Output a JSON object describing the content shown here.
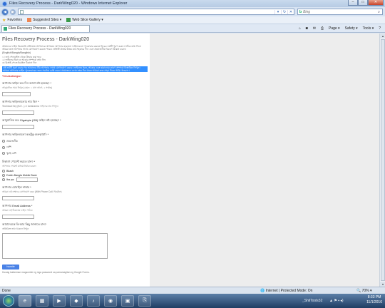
{
  "window": {
    "title": "Files Recovery Process - DarkWing020 - Windows Internet Explorer",
    "min": "–",
    "max": "□",
    "close": "✕"
  },
  "address": {
    "back": "◀",
    "forward": "▶",
    "url": "",
    "search_placeholder": "Bing",
    "search_brand": "b"
  },
  "favorites": {
    "label": "Favorites",
    "items": [
      "Suggested Sites ▾",
      "Web Slice Gallery ▾"
    ]
  },
  "tab": {
    "label": "Files Recovery Process - DarkWing020"
  },
  "toolbar": {
    "page": "Page ▾",
    "safety": "Safety ▾",
    "tools": "Tools ▾",
    "help": "?"
  },
  "form": {
    "title": "Files Recovery Process - DarkWing020",
    "intro": "আমাদের ফাইল রিকভারি প্রক্রিয়ায় আপনাকে স্বাগতম। আপনার হারানো ফাইলগুলো পুনরুদ্ধার করতে নিচের ফর্মটি পূরণ করুন। সঠিক তথ্য দিলে আমরা দ্রুত আপনার সাথে যোগাযোগ করতে পারব। প্রতিটি প্রশ্নের উত্তর যত্ন সহকারে দিন এবং প্রয়োজনীয় বিবরণ উল্লেখ করুন। (English/Bangla/Banglish)",
    "note1": "১। শুধু পেনড্রাইভ থেকে উদ্ধার করা হবে",
    "note2": "২। ফাইলের ধরন ও আকার সম্পর্কে তথ্য দিন",
    "note3": "৩। রিপ্লাই পেতে ইমেইল ঠিকানা দিন",
    "highlight": "এই ফর্মটি পূরণ করার পর আমাদের টিম আপনার সাথে যোগাযোগ করবে। ফাইলের ধরন, আকার এবং হারানোর কারণ সম্পর্কে বিস্তারিত লিখুন। আমরা আপনার ফাইল পুনরুদ্ধারের জন্য সর্বোচ্চ চেষ্টা করব। প্রয়োজনে ফোন নম্বর দিন যাতে আমরা দ্রুত সাড়া দিতে পারি। ধন্যবাদ।",
    "required": "*Kinakailangan",
    "questions": [
      {
        "q": "আপনার ফাইল কত দিন আগে নষ্ট হয়েছে? *",
        "hint": "আনুমানিক সময় লিখুন (যেমন: ১ মাস আগে, ২ সপ্তাহ)"
      },
      {
        "q": "আপনার ফাইলগুলোর নাম কি? *",
        "hint": "Technical Key (B.E...) বা Anisharma ফাইলের নাম লিখুন।"
      },
      {
        "q": "আনুমানিক কত Gigabyte (GB) ফাইল নষ্ট হয়েছে? *",
        "hint": ""
      },
      {
        "q": "আপনার ফাইলগুলো কতটুকু গুরুত্বপূর্ণ? *",
        "hint": "",
        "options": [
          "প্রয়োজনীয়",
          "বেশি",
          "খুবই বেশি"
        ]
      },
      {
        "q": "বিকাশে পেমেন্ট করতে চান? *",
        "hint": "আপনার পেমেন্ট মাধ্যম নির্বাচন করুন",
        "options": [
          "Bkash",
          "Dutch-Bangla Mobile Bank",
          "Iba pa:"
        ]
      },
      {
        "q": "আপনার মোবাইল নাম্বার *",
        "hint": "আমরা এই নাম্বারে যোগাযোগ করব (With Phone Call / ইমেইল)"
      },
      {
        "q": "আপনার Email Address *",
        "hint": "আমরা এই ঠিকানায় ফাইল পাঠাব"
      },
      {
        "q": "আমাদেরকে কি আর কিছু জানাতে চান?",
        "hint": "অতিরিক্ত তথ্য থাকলে লিখুন"
      }
    ],
    "submit": "Isumite",
    "footer": "Huwag kailanman magsumite ng mga password sa pamamagitan ng Google Forms."
  },
  "status": {
    "left": "Done",
    "zone": "Internet | Protected Mode: On",
    "zoom": "70%"
  },
  "taskbar": {
    "apps": [
      "e",
      "▦",
      "▶",
      "◆",
      "♪",
      "◉",
      "▣",
      "⎘"
    ],
    "user": "_ShilTools32",
    "time": "8:33 PM",
    "date": "11/1/2016",
    "tray": "▲ ⚑ ▪ ◂)"
  }
}
